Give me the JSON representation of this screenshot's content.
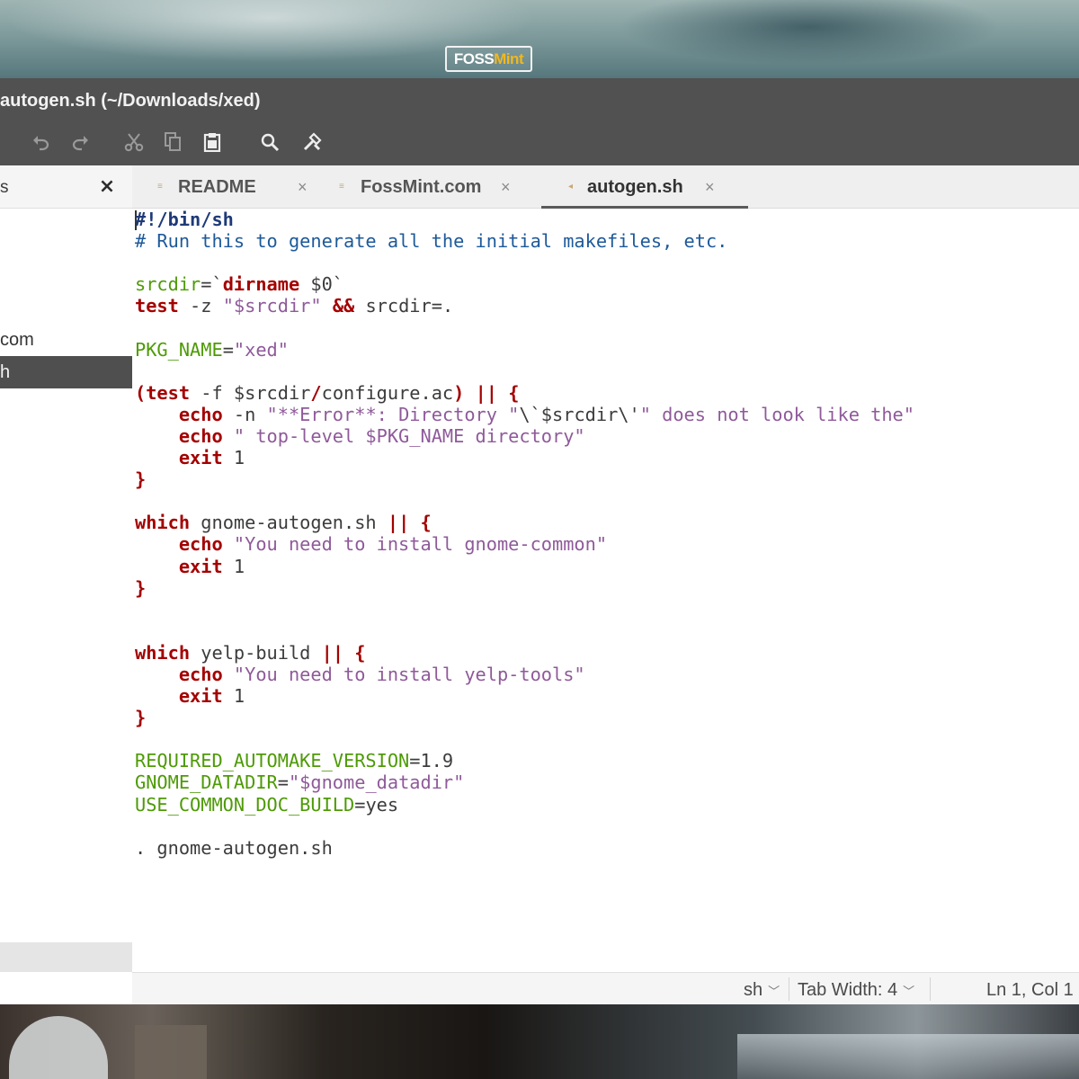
{
  "watermark": {
    "part1": "FOSS",
    "part2": "Mint"
  },
  "window": {
    "title": "autogen.sh (~/Downloads/xed)"
  },
  "toolbar": {
    "undo_icon": "undo-icon",
    "redo_icon": "redo-icon",
    "cut_icon": "cut-icon",
    "copy_icon": "copy-icon",
    "paste_icon": "paste-icon",
    "search_icon": "search-icon",
    "tools_icon": "tools-icon"
  },
  "side_panel": {
    "title": "s",
    "close_glyph": "×",
    "items": [
      "com",
      "h"
    ],
    "active_index": 1
  },
  "tabs": [
    {
      "label": "README",
      "close": "×",
      "active": false
    },
    {
      "label": "FossMint.com",
      "close": "×",
      "active": false
    },
    {
      "label": "autogen.sh",
      "close": "×",
      "active": true
    }
  ],
  "code": {
    "language": "sh",
    "lines": [
      "#!/bin/sh",
      "# Run this to generate all the initial makefiles, etc.",
      "",
      "srcdir=`dirname $0`",
      "test -z \"$srcdir\" && srcdir=.",
      "",
      "PKG_NAME=\"xed\"",
      "",
      "(test -f $srcdir/configure.ac) || {",
      "    echo -n \"**Error**: Directory \"\\`$srcdir\\'\" does not look like the\"",
      "    echo \" top-level $PKG_NAME directory\"",
      "    exit 1",
      "}",
      "",
      "which gnome-autogen.sh || {",
      "    echo \"You need to install gnome-common\"",
      "    exit 1",
      "}",
      "",
      "",
      "which yelp-build || {",
      "    echo \"You need to install yelp-tools\"",
      "    exit 1",
      "}",
      "",
      "REQUIRED_AUTOMAKE_VERSION=1.9",
      "GNOME_DATADIR=\"$gnome_datadir\"",
      "USE_COMMON_DOC_BUILD=yes",
      "",
      ". gnome-autogen.sh"
    ]
  },
  "statusbar": {
    "language": "sh",
    "tab_width_label": "Tab Width:",
    "tab_width_value": "4",
    "position": "Ln 1, Col 1"
  }
}
